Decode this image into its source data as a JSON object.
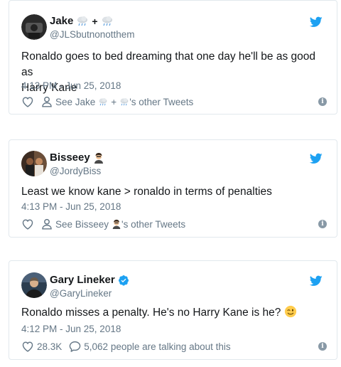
{
  "tweets": [
    {
      "name": "Jake",
      "name_plus": "+",
      "handle": "@JLSbutnonotthem",
      "text_line1": "Ronaldo goes to bed dreaming that one day he'll be as good as",
      "text_line2": "Harry Kane",
      "timestamp": "4:13 PM - Jun 25, 2018",
      "see_prefix": "See Jake",
      "see_plus": "+",
      "see_suffix": "'s other Tweets",
      "icons": [
        "heart-icon",
        "person-icon",
        "info-icon",
        "twitter-bird-icon",
        "cloud-rain-emoji"
      ]
    },
    {
      "name": "Bisseey",
      "handle": "@JordyBiss",
      "text": "Least we know kane > ronaldo in terms of penalties",
      "timestamp": "4:13 PM - Jun 25, 2018",
      "see_prefix": "See Bisseey",
      "see_suffix": "'s other Tweets",
      "icons": [
        "heart-icon",
        "person-icon",
        "info-icon",
        "twitter-bird-icon",
        "person-emoji"
      ]
    },
    {
      "name": "Gary Lineker",
      "handle": "@GaryLineker",
      "text": "Ronaldo misses a penalty. He's no Harry Kane is he?",
      "timestamp": "4:12 PM - Jun 25, 2018",
      "likes": "28.3K",
      "talking": "5,062 people are talking about this",
      "icons": [
        "heart-icon",
        "comment-icon",
        "info-icon",
        "twitter-bird-icon",
        "verified-badge-icon",
        "wink-emoji"
      ]
    }
  ],
  "colors": {
    "twitter_blue": "#1da1f2",
    "text_primary": "#14171a",
    "text_secondary": "#657786",
    "border": "#e1e8ed"
  }
}
